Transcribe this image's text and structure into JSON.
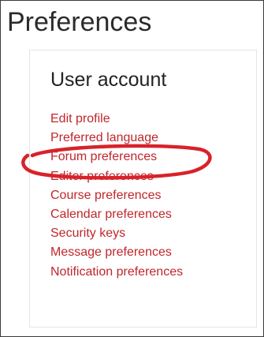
{
  "page": {
    "title": "Preferences"
  },
  "user_account": {
    "heading": "User account",
    "links": [
      {
        "label": "Edit profile"
      },
      {
        "label": "Preferred language"
      },
      {
        "label": "Forum preferences"
      },
      {
        "label": "Editor preferences"
      },
      {
        "label": "Course preferences"
      },
      {
        "label": "Calendar preferences"
      },
      {
        "label": "Security keys"
      },
      {
        "label": "Message preferences"
      },
      {
        "label": "Notification preferences"
      }
    ]
  },
  "colors": {
    "link": "#c0262c",
    "highlight": "#d8222a",
    "heading": "#222222"
  }
}
